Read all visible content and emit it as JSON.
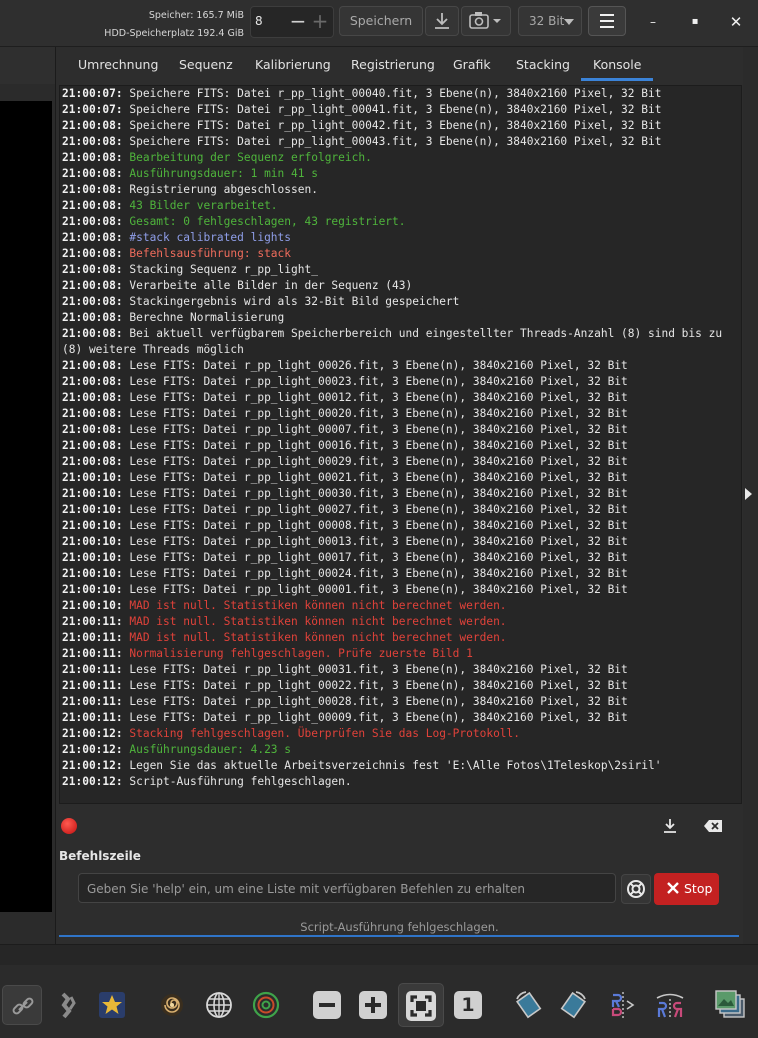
{
  "header": {
    "memory_label": "Speicher: 165.7 MiB",
    "disk_label": "HDD-Speicherplatz 192.4 GiB",
    "thread_value": "8",
    "save_label": "Speichern",
    "bit_depth": "32 Bit",
    "minimize_glyph": "–",
    "maximize_glyph": "▪",
    "close_glyph": "✕"
  },
  "tabs": [
    {
      "label": "Umrechnung"
    },
    {
      "label": "Sequenz"
    },
    {
      "label": "Kalibrierung"
    },
    {
      "label": "Registrierung"
    },
    {
      "label": "Grafik"
    },
    {
      "label": "Stacking"
    },
    {
      "label": "Konsole"
    }
  ],
  "console": {
    "lines": [
      {
        "ts": "21:00:07:",
        "msg": " Speichere FITS: Datei r_pp_light_00040.fit, 3 Ebene(n), 3840x2160 Pixel, 32 Bit",
        "type": "normal"
      },
      {
        "ts": "21:00:07:",
        "msg": " Speichere FITS: Datei r_pp_light_00041.fit, 3 Ebene(n), 3840x2160 Pixel, 32 Bit",
        "type": "normal"
      },
      {
        "ts": "21:00:08:",
        "msg": " Speichere FITS: Datei r_pp_light_00042.fit, 3 Ebene(n), 3840x2160 Pixel, 32 Bit",
        "type": "normal"
      },
      {
        "ts": "21:00:08:",
        "msg": " Speichere FITS: Datei r_pp_light_00043.fit, 3 Ebene(n), 3840x2160 Pixel, 32 Bit",
        "type": "normal"
      },
      {
        "ts": "21:00:08:",
        "msg": " Bearbeitung der Sequenz erfolgreich.",
        "type": "green"
      },
      {
        "ts": "21:00:08:",
        "msg": " Ausführungsdauer: 1 min 41 s",
        "type": "green"
      },
      {
        "ts": "21:00:08:",
        "msg": " Registrierung abgeschlossen.",
        "type": "normal"
      },
      {
        "ts": "21:00:08:",
        "msg": " 43 Bilder verarbeitet.",
        "type": "green"
      },
      {
        "ts": "21:00:08:",
        "msg": " Gesamt: 0 fehlgeschlagen, 43 registriert.",
        "type": "green"
      },
      {
        "ts": "21:00:08:",
        "msg": " #stack calibrated lights",
        "type": "blue"
      },
      {
        "ts": "21:00:08:",
        "msg": " Befehlsausführung: stack",
        "type": "salmon"
      },
      {
        "ts": "21:00:08:",
        "msg": " Stacking Sequenz r_pp_light_",
        "type": "normal"
      },
      {
        "ts": "21:00:08:",
        "msg": " Verarbeite alle Bilder in der Sequenz (43)",
        "type": "normal"
      },
      {
        "ts": "21:00:08:",
        "msg": " Stackingergebnis wird als 32-Bit Bild gespeichert",
        "type": "normal"
      },
      {
        "ts": "21:00:08:",
        "msg": " Berechne Normalisierung",
        "type": "normal"
      },
      {
        "ts": "21:00:08:",
        "msg": " Bei aktuell verfügbarem Speicherbereich und eingestellter Threads-Anzahl (8) sind bis zu (8) weitere Threads möglich",
        "type": "normal"
      },
      {
        "ts": "21:00:08:",
        "msg": " Lese FITS: Datei r_pp_light_00026.fit, 3 Ebene(n), 3840x2160 Pixel, 32 Bit",
        "type": "normal"
      },
      {
        "ts": "21:00:08:",
        "msg": " Lese FITS: Datei r_pp_light_00023.fit, 3 Ebene(n), 3840x2160 Pixel, 32 Bit",
        "type": "normal"
      },
      {
        "ts": "21:00:08:",
        "msg": " Lese FITS: Datei r_pp_light_00012.fit, 3 Ebene(n), 3840x2160 Pixel, 32 Bit",
        "type": "normal"
      },
      {
        "ts": "21:00:08:",
        "msg": " Lese FITS: Datei r_pp_light_00020.fit, 3 Ebene(n), 3840x2160 Pixel, 32 Bit",
        "type": "normal"
      },
      {
        "ts": "21:00:08:",
        "msg": " Lese FITS: Datei r_pp_light_00007.fit, 3 Ebene(n), 3840x2160 Pixel, 32 Bit",
        "type": "normal"
      },
      {
        "ts": "21:00:08:",
        "msg": " Lese FITS: Datei r_pp_light_00016.fit, 3 Ebene(n), 3840x2160 Pixel, 32 Bit",
        "type": "normal"
      },
      {
        "ts": "21:00:08:",
        "msg": " Lese FITS: Datei r_pp_light_00029.fit, 3 Ebene(n), 3840x2160 Pixel, 32 Bit",
        "type": "normal"
      },
      {
        "ts": "21:00:10:",
        "msg": " Lese FITS: Datei r_pp_light_00021.fit, 3 Ebene(n), 3840x2160 Pixel, 32 Bit",
        "type": "normal"
      },
      {
        "ts": "21:00:10:",
        "msg": " Lese FITS: Datei r_pp_light_00030.fit, 3 Ebene(n), 3840x2160 Pixel, 32 Bit",
        "type": "normal"
      },
      {
        "ts": "21:00:10:",
        "msg": " Lese FITS: Datei r_pp_light_00027.fit, 3 Ebene(n), 3840x2160 Pixel, 32 Bit",
        "type": "normal"
      },
      {
        "ts": "21:00:10:",
        "msg": " Lese FITS: Datei r_pp_light_00008.fit, 3 Ebene(n), 3840x2160 Pixel, 32 Bit",
        "type": "normal"
      },
      {
        "ts": "21:00:10:",
        "msg": " Lese FITS: Datei r_pp_light_00013.fit, 3 Ebene(n), 3840x2160 Pixel, 32 Bit",
        "type": "normal"
      },
      {
        "ts": "21:00:10:",
        "msg": " Lese FITS: Datei r_pp_light_00017.fit, 3 Ebene(n), 3840x2160 Pixel, 32 Bit",
        "type": "normal"
      },
      {
        "ts": "21:00:10:",
        "msg": " Lese FITS: Datei r_pp_light_00024.fit, 3 Ebene(n), 3840x2160 Pixel, 32 Bit",
        "type": "normal"
      },
      {
        "ts": "21:00:10:",
        "msg": " Lese FITS: Datei r_pp_light_00001.fit, 3 Ebene(n), 3840x2160 Pixel, 32 Bit",
        "type": "normal"
      },
      {
        "ts": "21:00:10:",
        "msg": " MAD ist null. Statistiken können nicht berechnet werden.",
        "type": "red"
      },
      {
        "ts": "21:00:11:",
        "msg": " MAD ist null. Statistiken können nicht berechnet werden.",
        "type": "red"
      },
      {
        "ts": "21:00:11:",
        "msg": " MAD ist null. Statistiken können nicht berechnet werden.",
        "type": "red"
      },
      {
        "ts": "21:00:11:",
        "msg": " Normalisierung fehlgeschlagen. Prüfe zuerste Bild 1",
        "type": "red"
      },
      {
        "ts": "21:00:11:",
        "msg": " Lese FITS: Datei r_pp_light_00031.fit, 3 Ebene(n), 3840x2160 Pixel, 32 Bit",
        "type": "normal"
      },
      {
        "ts": "21:00:11:",
        "msg": " Lese FITS: Datei r_pp_light_00022.fit, 3 Ebene(n), 3840x2160 Pixel, 32 Bit",
        "type": "normal"
      },
      {
        "ts": "21:00:11:",
        "msg": " Lese FITS: Datei r_pp_light_00028.fit, 3 Ebene(n), 3840x2160 Pixel, 32 Bit",
        "type": "normal"
      },
      {
        "ts": "21:00:11:",
        "msg": " Lese FITS: Datei r_pp_light_00009.fit, 3 Ebene(n), 3840x2160 Pixel, 32 Bit",
        "type": "normal"
      },
      {
        "ts": "21:00:12:",
        "msg": " Stacking fehlgeschlagen. Überprüfen Sie das Log-Protokoll.",
        "type": "red"
      },
      {
        "ts": "21:00:12:",
        "msg": " Ausführungsdauer: 4.23 s",
        "type": "green"
      },
      {
        "ts": "21:00:12:",
        "msg": " Legen Sie das aktuelle Arbeitsverzeichnis fest 'E:\\Alle Fotos\\1Teleskop\\2siril'",
        "type": "normal"
      },
      {
        "ts": "21:00:12:",
        "msg": " Script-Ausführung fehlgeschlagen.",
        "type": "normal"
      }
    ]
  },
  "command": {
    "section_label": "Befehlszeile",
    "placeholder": "Geben Sie 'help' ein, um eine Liste mit verfügbaren Befehlen zu erhalten",
    "stop_label": "Stop",
    "status": "Script-Ausführung fehlgeschlagen."
  },
  "toolbar": {
    "icons": [
      "link-icon",
      "photometry-icon",
      "star-icon",
      "galaxy-icon",
      "globe-icon",
      "target-icon",
      "zoom-out-icon",
      "zoom-in-icon",
      "zoom-fit-icon",
      "zoom-100-icon",
      "rotate-left-icon",
      "rotate-right-icon",
      "mirror-x-icon",
      "mirror-y-icon",
      "gallery-icon"
    ],
    "zoom_100_label": "1"
  },
  "colors": {
    "accent": "#3b83d8",
    "stop": "#c32121",
    "log_green": "#4fb43c",
    "log_red": "#e0423a",
    "log_blue": "#8f9ee8"
  }
}
